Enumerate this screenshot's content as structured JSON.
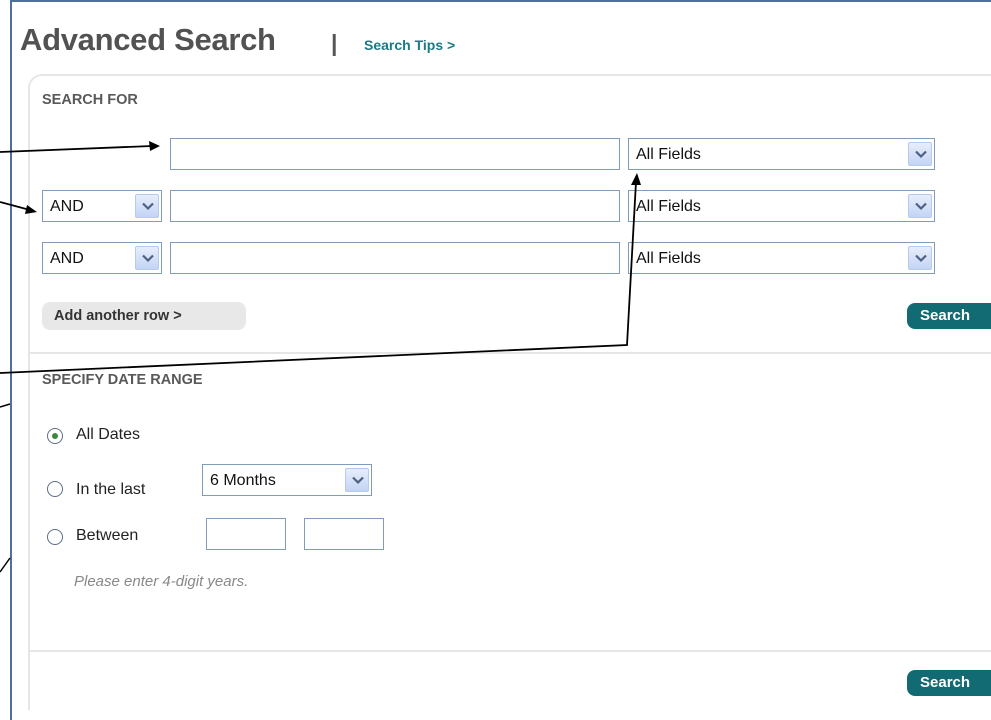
{
  "page": {
    "title": "Advanced Search",
    "separator": "|",
    "tips_link": "Search Tips >"
  },
  "search_for": {
    "heading": "SEARCH FOR",
    "rows": [
      {
        "operator": "",
        "term": "",
        "field": "All Fields"
      },
      {
        "operator": "AND",
        "term": "",
        "field": "All Fields"
      },
      {
        "operator": "AND",
        "term": "",
        "field": "All Fields"
      }
    ],
    "add_row_label": "Add another row >",
    "search_label": "Search"
  },
  "date_range": {
    "heading": "SPECIFY DATE RANGE",
    "options": {
      "all_dates": "All Dates",
      "in_the_last": "In the last",
      "between": "Between"
    },
    "selected": "all_dates",
    "last_period": "6 Months",
    "hint": "Please enter 4-digit years.",
    "search_label": "Search"
  },
  "icons": {
    "dropdown": "chevron-down-icon",
    "annotation": "arrow-icon"
  },
  "colors": {
    "accent": "#126b72",
    "link": "#1a7a86",
    "frame": "#4f6fa0"
  }
}
